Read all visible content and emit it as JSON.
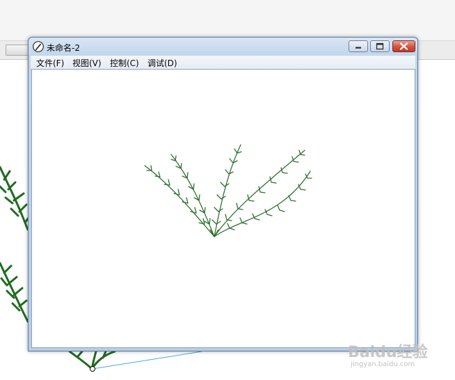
{
  "window": {
    "title": "未命名-2",
    "menu": {
      "file": "文件(F)",
      "view": "视图(V)",
      "control": "控制(C)",
      "debug": "调试(D)"
    }
  },
  "watermark": {
    "brand": "Baidu经验",
    "url": "jingyan.baidu.com"
  },
  "colors": {
    "plant_stroke": "#2f6f2f",
    "bg_plant_stroke": "#1f6b1f",
    "line_accent": "#4aa8d8"
  },
  "icons": {
    "app": "pen-nib-icon",
    "minimize": "minimize-icon",
    "maximize": "maximize-icon",
    "close": "close-icon"
  }
}
